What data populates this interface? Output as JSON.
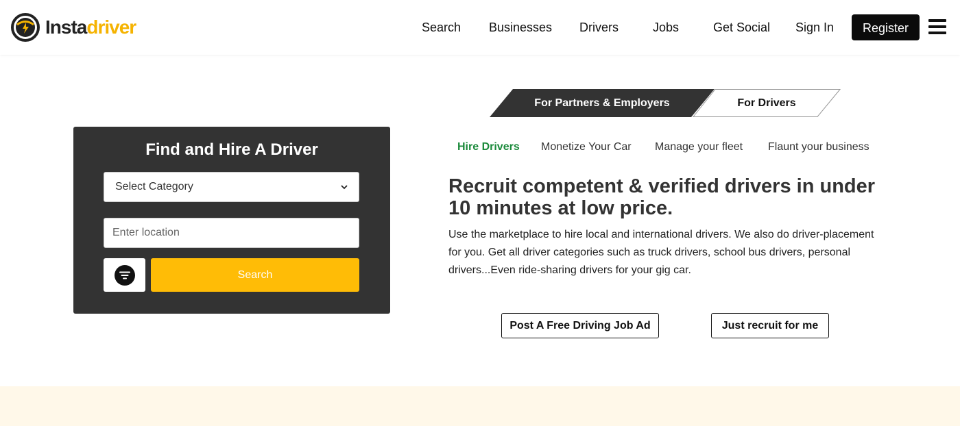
{
  "brand": {
    "insta": "Insta",
    "driver": "driver",
    "accent": "#f5b301"
  },
  "nav": {
    "items": [
      "Search",
      "Businesses",
      "Drivers",
      "Jobs",
      "Get Social",
      "Sign In"
    ],
    "register_label": "Register",
    "menu_icon": "hamburger-icon"
  },
  "search_card": {
    "title": "Find and Hire A Driver",
    "category_selected": "Select Category",
    "location_placeholder": "Enter location",
    "filter_icon": "filter-icon",
    "search_label": "Search",
    "button_color": "#ffbc06"
  },
  "audience_tabs": {
    "partners_label": "For Partners & Employers",
    "drivers_label": "For Drivers",
    "active": "For Partners & Employers"
  },
  "sub_tabs": {
    "items": [
      "Hire Drivers",
      "Monetize Your Car",
      "Manage your fleet",
      "Flaunt your business"
    ],
    "active": "Hire Drivers",
    "active_color": "#1b8a3b"
  },
  "hero": {
    "headline": "Recruit competent & verified drivers in under 10 minutes at low price.",
    "description": "Use the marketplace to hire local and international drivers. We also do driver-placement for you. Get all driver categories such as truck drivers, school bus drivers, personal drivers...Even ride-sharing drivers for your gig car.",
    "cta_post": "Post A Free Driving Job Ad",
    "cta_recruit": "Just recruit for me"
  }
}
